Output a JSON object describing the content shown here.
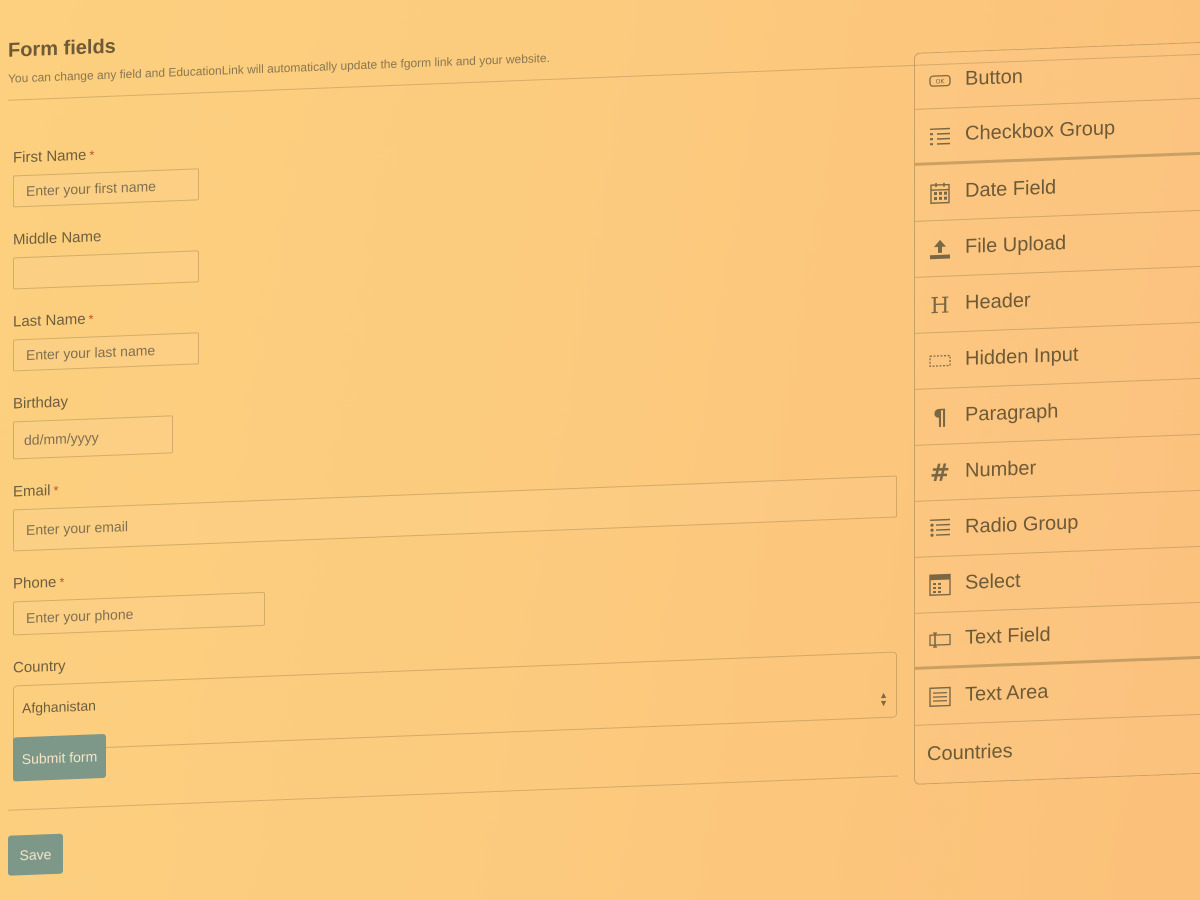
{
  "header": {
    "title": "Form fields",
    "subtitle": "You can change any field and EducationLink will automatically update the fgorm link and your website."
  },
  "form": {
    "first_name": {
      "label": "First Name",
      "required_mark": "*",
      "placeholder": "Enter your first name",
      "value": ""
    },
    "middle_name": {
      "label": "Middle Name",
      "placeholder": "",
      "value": ""
    },
    "last_name": {
      "label": "Last Name",
      "required_mark": "*",
      "placeholder": "Enter your last name",
      "value": ""
    },
    "birthday": {
      "label": "Birthday",
      "placeholder": "dd/mm/yyyy",
      "value": ""
    },
    "email": {
      "label": "Email",
      "required_mark": "*",
      "placeholder": "Enter your email",
      "value": ""
    },
    "phone": {
      "label": "Phone",
      "required_mark": "*",
      "placeholder": "Enter your phone",
      "value": ""
    },
    "country": {
      "label": "Country",
      "selected": "Afghanistan"
    },
    "submit_label": "Submit form"
  },
  "footer": {
    "save_label": "Save"
  },
  "panel": {
    "items": [
      {
        "label": "Button",
        "icon": "button-icon"
      },
      {
        "label": "Checkbox Group",
        "icon": "checkbox-group-icon"
      },
      {
        "label": "Date Field",
        "icon": "calendar-icon"
      },
      {
        "label": "File Upload",
        "icon": "upload-icon"
      },
      {
        "label": "Header",
        "icon": "header-icon"
      },
      {
        "label": "Hidden Input",
        "icon": "hidden-input-icon"
      },
      {
        "label": "Paragraph",
        "icon": "paragraph-icon"
      },
      {
        "label": "Number",
        "icon": "number-icon"
      },
      {
        "label": "Radio Group",
        "icon": "radio-group-icon"
      },
      {
        "label": "Select",
        "icon": "select-icon"
      },
      {
        "label": "Text Field",
        "icon": "text-field-icon"
      },
      {
        "label": "Text Area",
        "icon": "text-area-icon"
      },
      {
        "label": "Countries",
        "icon": ""
      }
    ]
  },
  "colors": {
    "background": "#fccb7e",
    "text": "#6e5e3d",
    "required": "#c0522f",
    "button": "#7d9889",
    "button_text": "#f4e4c5"
  }
}
